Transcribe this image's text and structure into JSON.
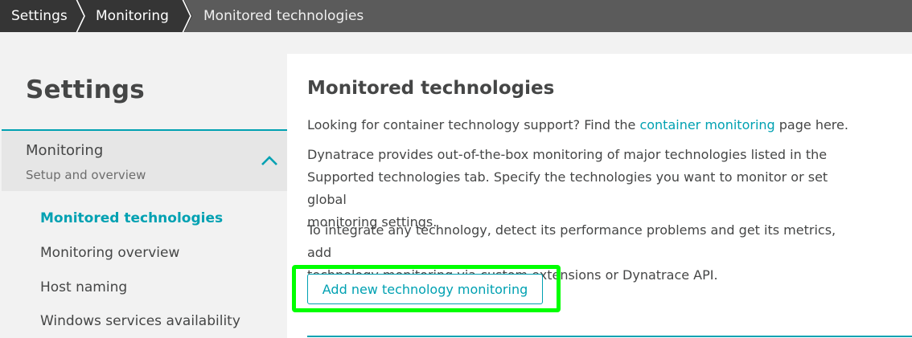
{
  "breadcrumb": {
    "items": [
      {
        "label": "Settings"
      },
      {
        "label": "Monitoring"
      },
      {
        "label": "Monitored technologies"
      }
    ]
  },
  "sidebar": {
    "title": "Settings",
    "group": {
      "title": "Monitoring",
      "subtitle": "Setup and overview",
      "expanded": true
    },
    "items": [
      {
        "label": "Monitored technologies",
        "active": true
      },
      {
        "label": "Monitoring overview",
        "active": false
      },
      {
        "label": "Host naming",
        "active": false
      },
      {
        "label": "Windows services availability",
        "active": false
      }
    ]
  },
  "main": {
    "title": "Monitored technologies",
    "intro": {
      "prefix": "Looking for container technology support? Find the ",
      "link": "container monitoring",
      "suffix": " page here."
    },
    "para2_line1": "Dynatrace provides out-of-the-box monitoring of major technologies listed in the",
    "para2_line2": "Supported technologies tab. Specify the technologies you want to monitor or set global",
    "para2_line3": "monitoring settings.",
    "para3_line1": "To integrate any technology, detect its performance problems and get its metrics, add",
    "para3_line2": "technology monitoring via custom extensions or Dynatrace API.",
    "add_button": "Add new technology monitoring"
  },
  "colors": {
    "accent": "#00a1b2",
    "breadcrumb_dark": "#353535",
    "breadcrumb_bar": "#5b5b5b",
    "highlight": "#00ff00"
  }
}
